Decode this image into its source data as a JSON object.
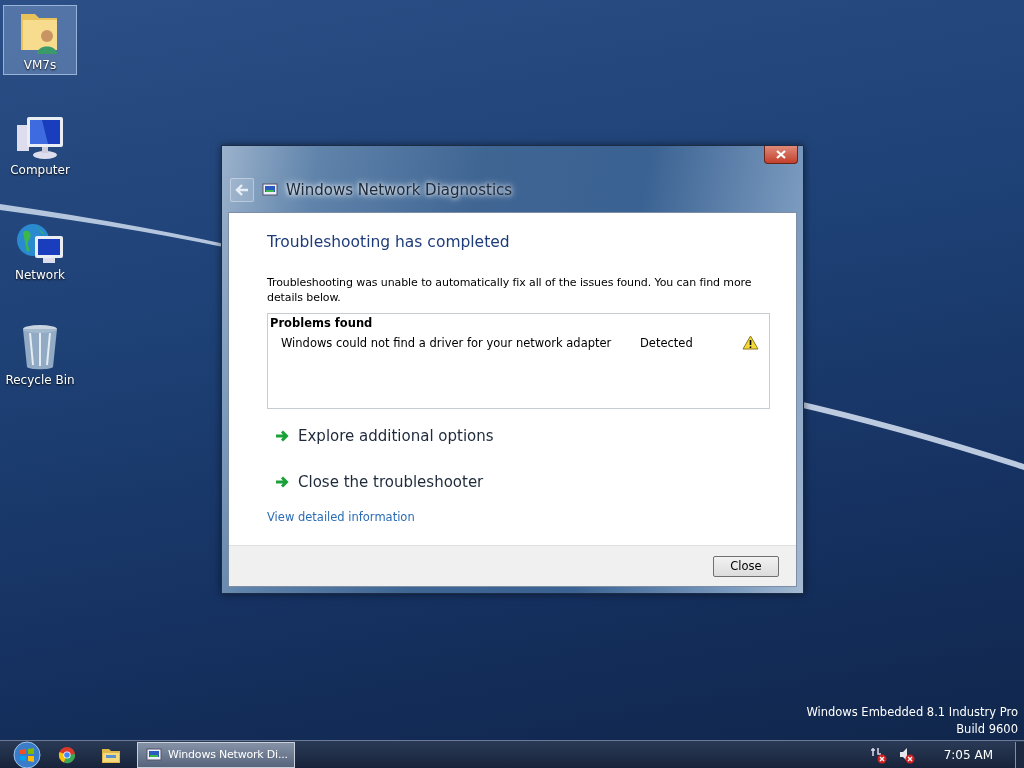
{
  "desktop_icons": [
    {
      "label": "VM7s",
      "kind": "user-folder",
      "selected": true
    },
    {
      "label": "Computer",
      "kind": "computer",
      "selected": false
    },
    {
      "label": "Network",
      "kind": "network",
      "selected": false
    },
    {
      "label": "Recycle Bin",
      "kind": "recycle-bin",
      "selected": false
    }
  ],
  "dialog": {
    "title": "Windows Network Diagnostics",
    "heading": "Troubleshooting has completed",
    "message": "Troubleshooting was unable to automatically fix all of the issues found. You can find more details below.",
    "problems": {
      "title": "Problems found",
      "rows": [
        {
          "description": "Windows could not find a driver for your network adapter",
          "status": "Detected"
        }
      ]
    },
    "actions": [
      "Explore additional options",
      "Close the troubleshooter"
    ],
    "link": "View detailed information",
    "buttons": [
      "Close"
    ]
  },
  "version_text": [
    "Windows Embedded 8.1 Industry Pro",
    "Build 9600"
  ],
  "taskbar": {
    "pinned": [
      {
        "kind": "browser"
      },
      {
        "kind": "folder"
      }
    ],
    "tasks": [
      {
        "label": "Windows Network Di...",
        "selected": true
      }
    ],
    "clock": "7:05 AM"
  }
}
